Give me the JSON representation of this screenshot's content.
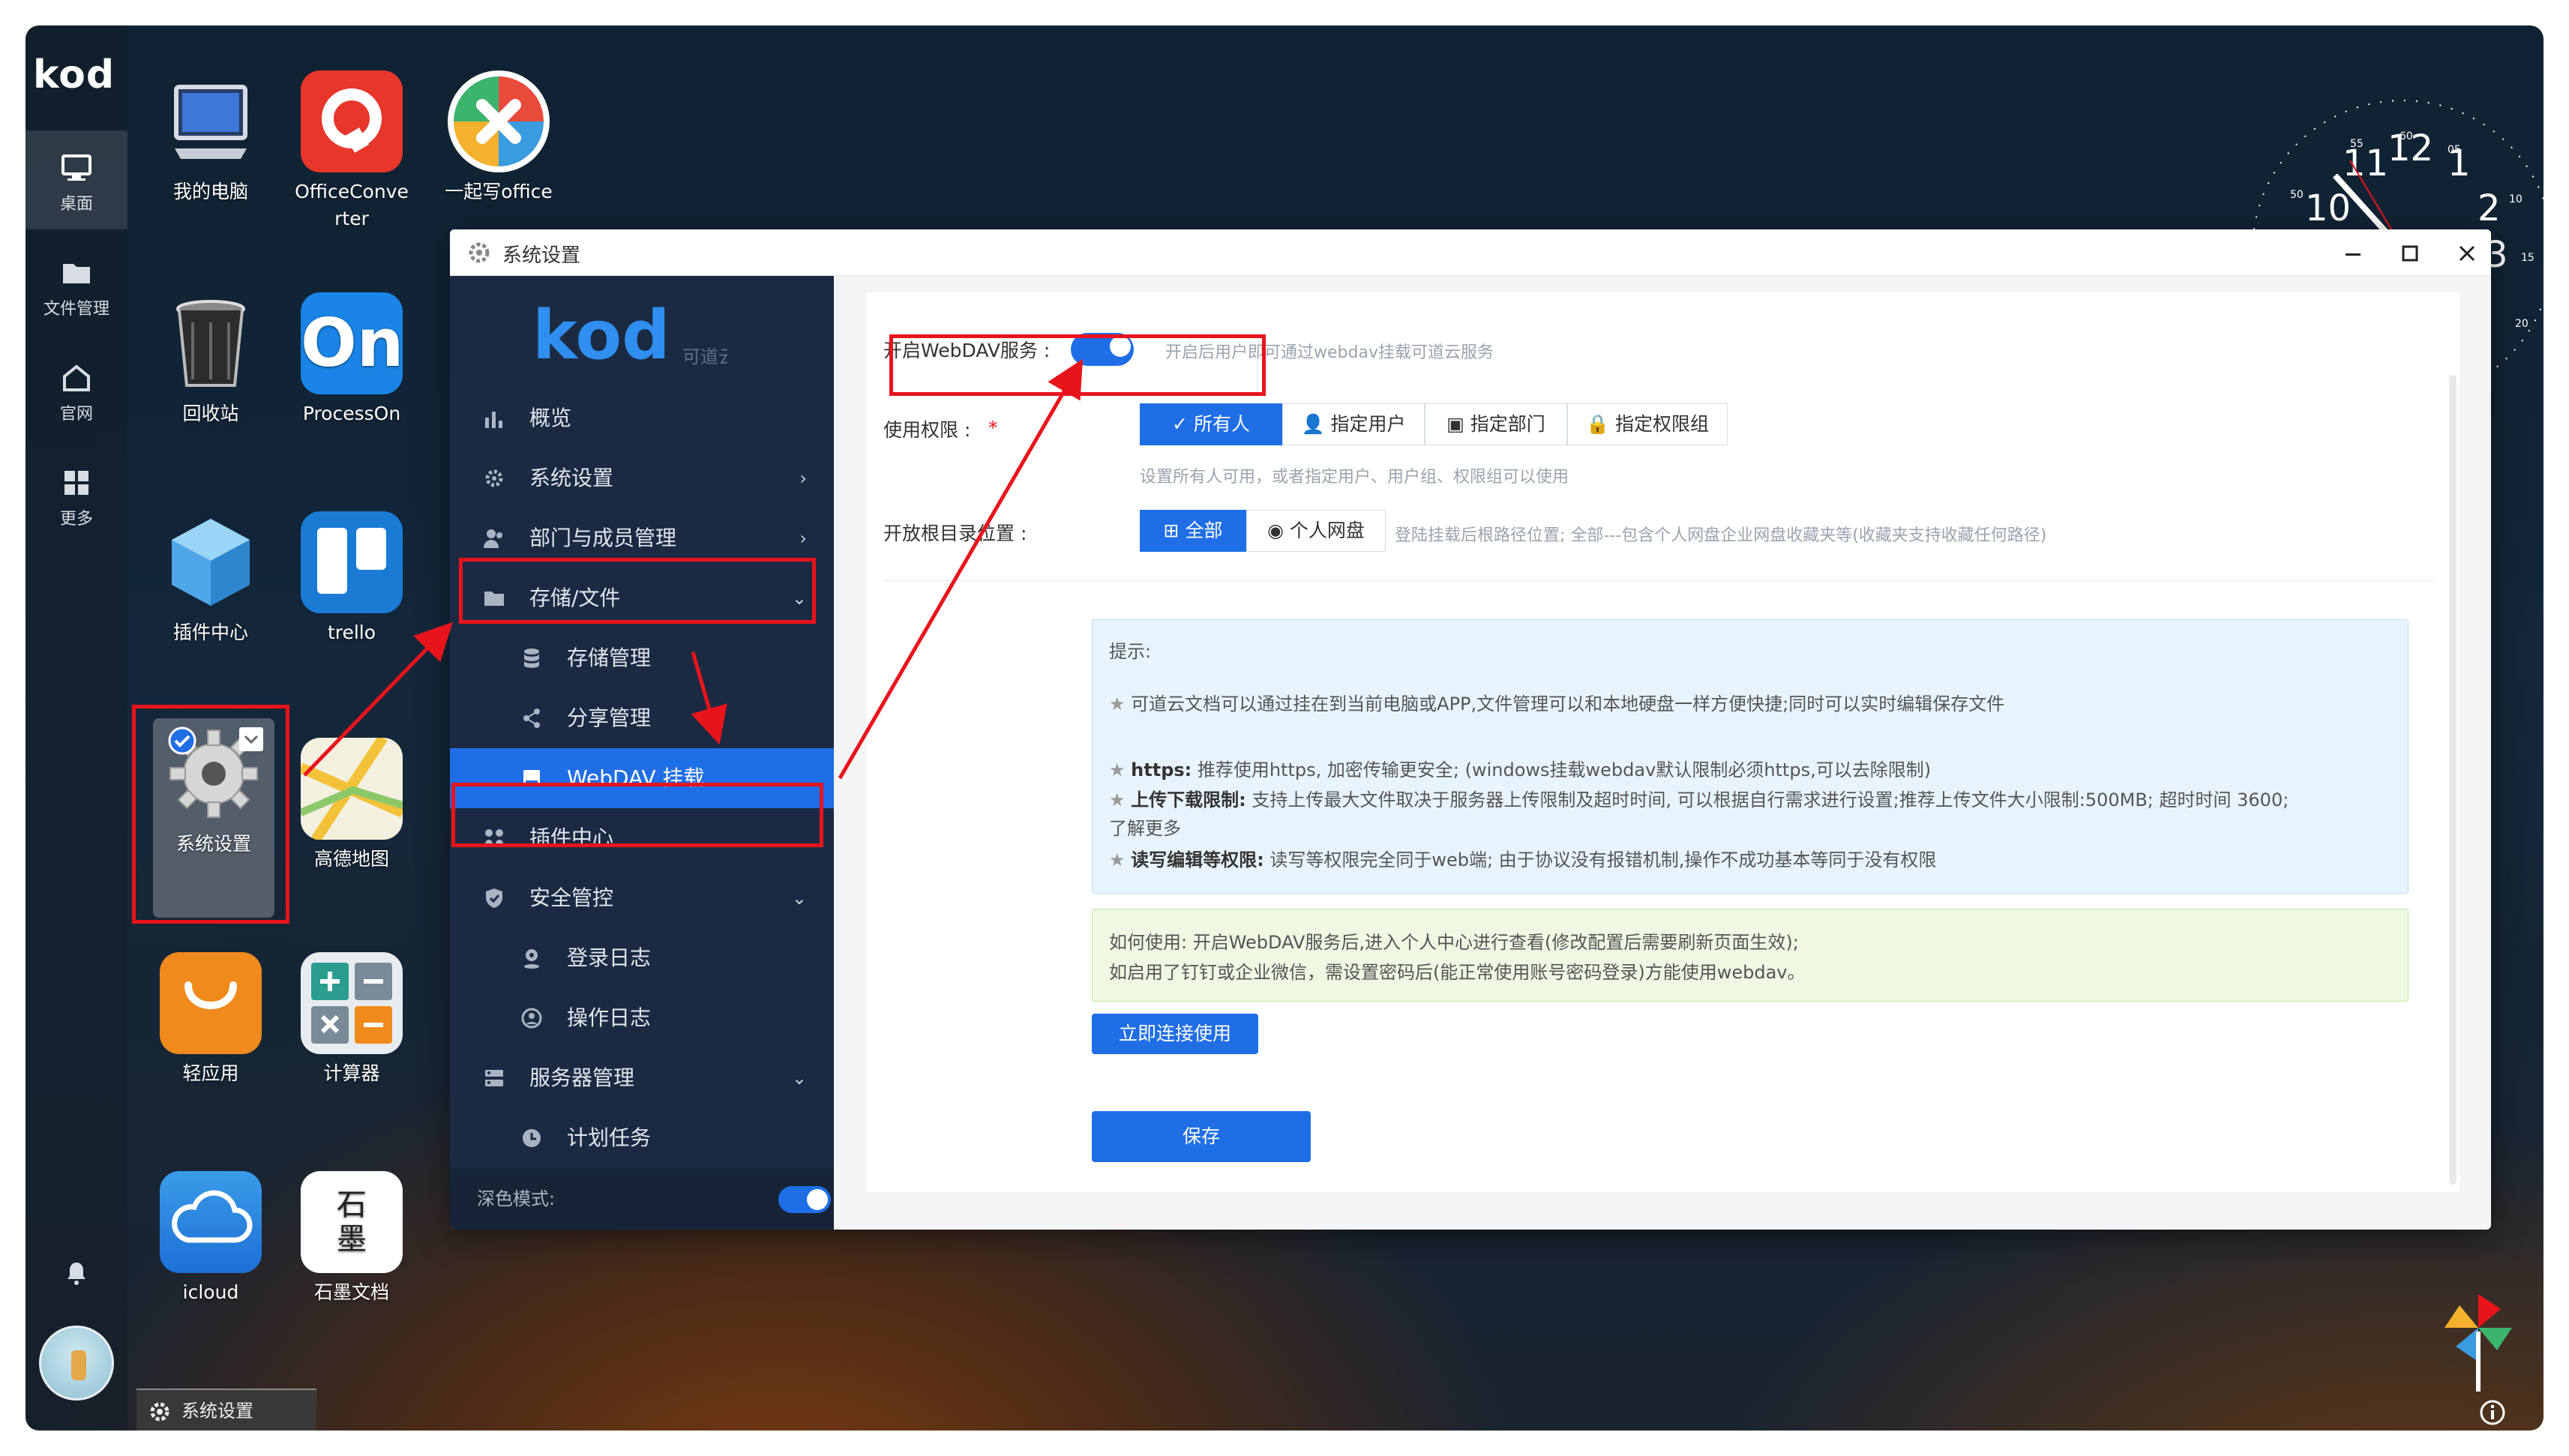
{
  "desktop": {
    "logo": "kod",
    "nav": [
      {
        "label": "桌面",
        "icon": "monitor-icon"
      },
      {
        "label": "文件管理",
        "icon": "folder-icon"
      },
      {
        "label": "官网",
        "icon": "home-icon"
      },
      {
        "label": "更多",
        "icon": "grid-icon"
      }
    ],
    "icons": [
      {
        "label": "我的电脑",
        "icon": "computer-icon"
      },
      {
        "label": "OfficeConverter",
        "label_l1": "OfficeConve",
        "label_l2": "rter",
        "icon": "office-converter-icon"
      },
      {
        "label": "一起写office",
        "icon": "yiqixie-icon"
      },
      {
        "label": "回收站",
        "icon": "trash-icon"
      },
      {
        "label": "ProcessOn",
        "icon": "processon-icon",
        "glyph": "On"
      },
      {
        "label": "插件中心",
        "icon": "plugin-cube-icon"
      },
      {
        "label": "trello",
        "icon": "trello-icon"
      },
      {
        "label": "系统设置",
        "icon": "settings-gear-icon"
      },
      {
        "label": "高德地图",
        "icon": "map-icon"
      },
      {
        "label": "轻应用",
        "icon": "bag-icon"
      },
      {
        "label": "计算器",
        "icon": "calculator-icon"
      },
      {
        "label": "icloud",
        "icon": "cloud-icon"
      },
      {
        "label": "石墨文档",
        "icon": "shimo-icon",
        "glyph1": "石",
        "glyph2": "墨"
      }
    ],
    "taskbar_label": "系统设置",
    "clock": {
      "numbers": [
        "11",
        "12",
        "1",
        "10",
        "2",
        "3"
      ],
      "minute_labels": [
        "55",
        "60",
        "05",
        "50",
        "10",
        "15",
        "20"
      ]
    }
  },
  "window": {
    "title": "系统设置",
    "logo_text": "kod",
    "logo_sub": "可道云",
    "menu": [
      {
        "label": "概览",
        "icon": "bar-chart-icon"
      },
      {
        "label": "系统设置",
        "icon": "gear-icon",
        "arrow": "›"
      },
      {
        "label": "部门与成员管理",
        "icon": "users-icon",
        "arrow": "›"
      },
      {
        "label": "存储/文件",
        "icon": "folder-icon",
        "arrow": "⌄"
      },
      {
        "label": "存储管理",
        "icon": "database-icon"
      },
      {
        "label": "分享管理",
        "icon": "share-icon"
      },
      {
        "label": "WebDAV 挂载",
        "icon": "drive-icon"
      },
      {
        "label": "插件中心",
        "icon": "apps-icon"
      },
      {
        "label": "安全管控",
        "icon": "shield-icon",
        "arrow": "⌄"
      },
      {
        "label": "登录日志",
        "icon": "pin-icon"
      },
      {
        "label": "操作日志",
        "icon": "user-circle-icon"
      },
      {
        "label": "服务器管理",
        "icon": "server-icon",
        "arrow": "⌄"
      },
      {
        "label": "计划任务",
        "icon": "clock-icon"
      }
    ],
    "dark_mode_label": "深色模式:",
    "form": {
      "webdav_label": "开启WebDAV服务 :",
      "webdav_hint": "开启后用户即可通过webdav挂载可道云服务",
      "perm_label": "使用权限 :",
      "perm_required": "*",
      "perm_options": [
        "所有人",
        "指定用户",
        "指定部门",
        "指定权限组"
      ],
      "perm_hint": "设置所有人可用，或者指定用户、用户组、权限组可以使用",
      "root_label": "开放根目录位置 :",
      "root_options": [
        "全部",
        "个人网盘"
      ],
      "root_hint": "登陆挂载后根路径位置; 全部---包含个人网盘企业网盘收藏夹等(收藏夹支持收藏任何路径)"
    },
    "tips": {
      "title": "提示:",
      "line1": "可道云文档可以通过挂在到当前电脑或APP,文件管理可以和本地硬盘一样方便快捷;同时可以实时编辑保存文件",
      "https_key": "https:",
      "https_text": " 推荐使用https, 加密传输更安全; (windows挂载webdav默认限制必须https,可以去除限制)",
      "upload_key": "上传下载限制:",
      "upload_text": " 支持上传最大文件取决于服务器上传限制及超时时间, 可以根据自行需求进行设置;推荐上传文件大小限制:500MB; 超时时间 3600;",
      "learn_more": "了解更多",
      "rw_key": "读写编辑等权限:",
      "rw_text": " 读写等权限完全同于web端; 由于协议没有报错机制,操作不成功基本等同于没有权限",
      "star": "★"
    },
    "usage": {
      "line1": "如何使用: 开启WebDAV服务后,进入个人中心进行查看(修改配置后需要刷新页面生效);",
      "line2": "如启用了钉钉或企业微信，需设置密码后(能正常使用账号密码登录)方能使用webdav。"
    },
    "connect_button": "立即连接使用",
    "save_button": "保存"
  },
  "colors": {
    "accent": "#1f6ee6",
    "sidebar": "#1b2a42",
    "annotation_red": "#e8141c"
  }
}
